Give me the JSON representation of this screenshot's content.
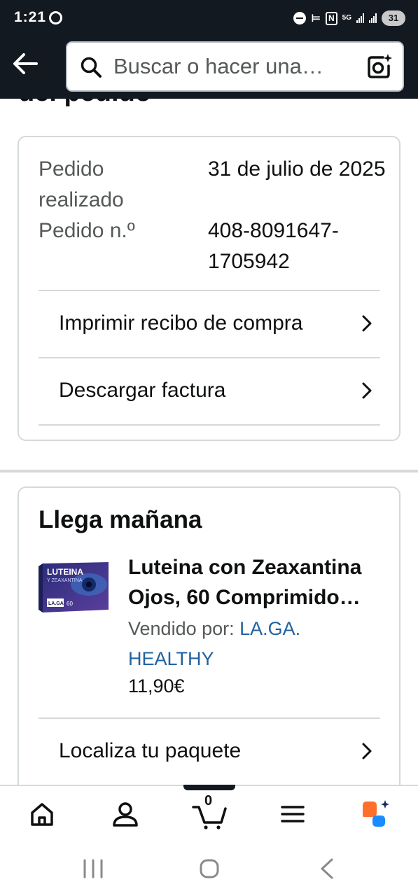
{
  "status_bar": {
    "time": "1:21",
    "network": "5G",
    "battery": "31"
  },
  "search": {
    "placeholder": "Buscar o hacer una…"
  },
  "page": {
    "partial_title": "del pedido"
  },
  "order_info": {
    "date_label": "Pedido realizado",
    "date_value": "31 de julio de 2025",
    "number_label": "Pedido n.º",
    "number_value": "408-8091647-1705942"
  },
  "actions": [
    {
      "label": "Imprimir recibo de compra"
    },
    {
      "label": "Descargar factura"
    }
  ],
  "shipment": {
    "title": "Llega mañana",
    "product_title": "Luteina con Zeaxantina Ojos, 60 Comprimido…",
    "sold_by_label": "Vendido por:",
    "seller": "LA.GA. HEALTHY",
    "price": "11,90€",
    "track_label": "Localiza tu paquete",
    "product_image_text": {
      "line1": "LUTEINA",
      "line2": "Y ZEAXANTINA",
      "brand": "LA.GA",
      "count": "60"
    }
  },
  "bottom_nav": {
    "cart_count": "0",
    "items": [
      "home",
      "account",
      "cart",
      "menu",
      "rufus"
    ]
  },
  "colors": {
    "header_bg": "#131921",
    "link_blue": "#2162a1",
    "border": "#d5d9d9",
    "rufus_orange": "#ff6f2c",
    "rufus_blue": "#1a8cff"
  }
}
